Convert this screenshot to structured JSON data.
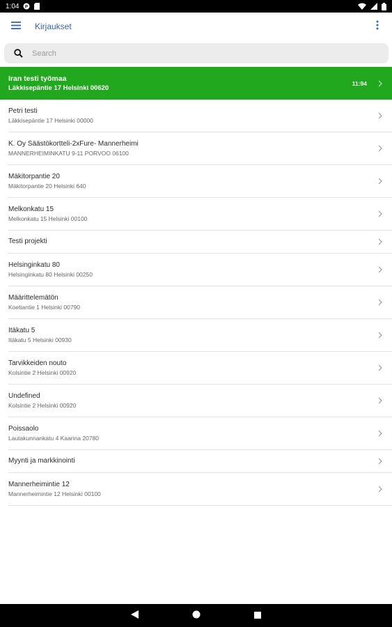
{
  "status_bar": {
    "time": "1:04"
  },
  "app_bar": {
    "title": "Kirjaukset"
  },
  "search": {
    "placeholder": "Search",
    "value": ""
  },
  "active_item": {
    "title": "Iran testi työmaa",
    "subtitle": "Läkkisepäntie 17 Helsinki 00620",
    "time": "11:94"
  },
  "items": [
    {
      "title": "Petri testi",
      "subtitle": "Läkkisepäntie 17 Helsinki 00000"
    },
    {
      "title": "K. Oy Säästökortteli-2xFure- Mannerheimi",
      "subtitle": "MANNERHEIMINKATU 9-11 PORVOO 06100"
    },
    {
      "title": "Mäkitorpantie 20",
      "subtitle": "Mäkitorpantie 20 Helsinki 640"
    },
    {
      "title": "Melkonkatu 15",
      "subtitle": "Melkonkatu 15 Helsinki 00100"
    },
    {
      "title": "Testi projekti",
      "subtitle": ""
    },
    {
      "title": "Helsinginkatu 80",
      "subtitle": "Helsinginkatu 80 Helsinki 00250"
    },
    {
      "title": "Määrittelemätön",
      "subtitle": "Koetiantie 1 Helsinki 00790"
    },
    {
      "title": "Itäkatu 5",
      "subtitle": "Itäkatu 5 Helsinki 00930"
    },
    {
      "title": "Tarvikkeiden nouto",
      "subtitle": "Kolsintie 2 Helsinki 00920"
    },
    {
      "title": "Undefined",
      "subtitle": "Kolsintie 2 Helsinki 00920"
    },
    {
      "title": "Poissaolo",
      "subtitle": "Lautakunnankatu 4 Kaarina 20780"
    },
    {
      "title": "Myynti ja markkinointi",
      "subtitle": ""
    },
    {
      "title": "Mannerheimintie 12",
      "subtitle": "Mannerheimintie 12 Helsinki 00100"
    }
  ],
  "icons": {
    "menu": "menu-icon",
    "overflow": "more-vert-icon",
    "search": "search-icon",
    "chevron": "chevron-right-icon",
    "nav_back": "back-icon",
    "nav_home": "home-icon",
    "nav_recents": "recents-icon"
  },
  "colors": {
    "accent": "#22a81f",
    "title_blue": "#3a62a6",
    "search_bg": "#ececec"
  }
}
